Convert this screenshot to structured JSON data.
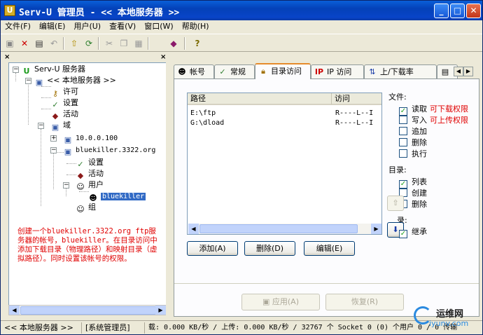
{
  "window": {
    "title": "Serv-U 管理员 - << 本地服务器 >>",
    "controls": {
      "minimize": "_",
      "maximize": "□",
      "close": "✕"
    }
  },
  "menu": [
    "文件(F)",
    "编辑(E)",
    "用户(U)",
    "查看(V)",
    "窗口(W)",
    "帮助(H)"
  ],
  "toolbar_icons": [
    "save-icon",
    "delete-icon",
    "new-icon",
    "undo-icon",
    "folder-up-icon",
    "refresh-icon",
    "cut-icon",
    "copy-icon",
    "paste-icon",
    "book-icon",
    "help-icon"
  ],
  "tree": {
    "root": "Serv-U 服务器",
    "server": "<< 本地服务器 >>",
    "license": "许可",
    "settings": "设置",
    "activity": "活动",
    "domains": "域",
    "domain1": "10.0.0.100",
    "domain2": "bluekiller.3322.org",
    "d2_settings": "设置",
    "d2_activity": "活动",
    "d2_users": "用户",
    "d2_user": "bluekiller",
    "d2_groups": "组"
  },
  "note": "创建一个bluekiller.3322.org ftp服务器的帐号，bluekiller。在目录访问中添加下载目录（物理路径）和映射目录（虚拟路径）。同时设置该帐号的权限。",
  "tabs": [
    "帐号",
    "常规",
    "目录访问",
    "IP 访问",
    "上/下载率"
  ],
  "active_tab": "目录访问",
  "list": {
    "headers": [
      "路径",
      "访问"
    ],
    "rows": [
      {
        "path": "E:\\ftp",
        "access": "R----L--I"
      },
      {
        "path": "G:\\dload",
        "access": "R----L--I"
      }
    ]
  },
  "buttons": {
    "add": "添加(A)",
    "delete": "删除(D)",
    "edit": "编辑(E)",
    "apply": "应用(A)",
    "restore": "恢复(R)"
  },
  "files_group": {
    "title": "文件:",
    "read": "读取",
    "read_note": "可下载权限",
    "write": "写入",
    "write_note": "可上传权限",
    "append": "追加",
    "delete": "删除",
    "execute": "执行"
  },
  "dirs_group": {
    "title": "目录:",
    "list": "列表",
    "create": "创建",
    "remove": "删除"
  },
  "sub_group": {
    "title": "录:",
    "inherit": "继承"
  },
  "checks": {
    "read": true,
    "write": false,
    "append": false,
    "delete": false,
    "execute": false,
    "list": true,
    "create": false,
    "remove": false,
    "inherit": true
  },
  "status": {
    "server": "<< 本地服务器 >>",
    "role": "[系统管理员]",
    "stats": "载: 0.000 KB/秒 / 上传: 0.000 KB/秒 / 32767 个 Socket 0 (0) 个用户 0 / 0 传输"
  },
  "watermark": {
    "line1": "运维网",
    "line2": "iyunv.com"
  }
}
